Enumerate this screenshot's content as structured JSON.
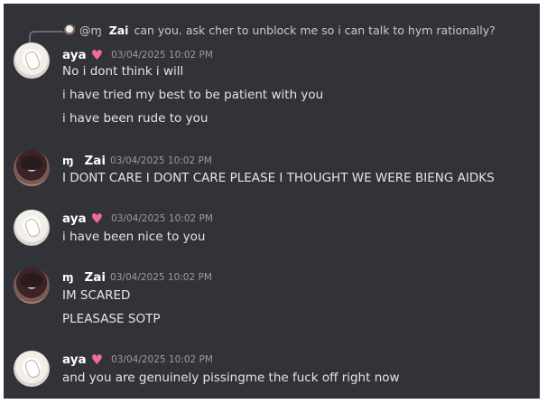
{
  "reply": {
    "avatar_icon": "user-avatar-icon",
    "mention": "@",
    "clan_icon": "ɱ",
    "author": "Zai",
    "text": "can you. ask cher to unblock me so i can talk to hym rationally?"
  },
  "messages": [
    {
      "author": "aya",
      "badge_icon": "heart-icon",
      "badge_glyph": "♥",
      "badge_color": "#f06aa1",
      "timestamp": "03/04/2025 10:02 PM",
      "lines": [
        "No i dont think i will",
        "i have tried my best to be patient with you",
        "i have been rude to you"
      ]
    },
    {
      "author": "Zai",
      "clan_glyph": "ɱ",
      "timestamp": "03/04/2025 10:02 PM",
      "lines": [
        "I DONT CARE I DONT CARE PLEASE I THOUGHT WE WERE BIENG AIDKS"
      ]
    },
    {
      "author": "aya",
      "badge_icon": "heart-icon",
      "badge_glyph": "♥",
      "badge_color": "#f06aa1",
      "timestamp": "03/04/2025 10:02 PM",
      "lines": [
        "i have been nice to you"
      ]
    },
    {
      "author": "Zai",
      "clan_glyph": "ɱ",
      "timestamp": "03/04/2025 10:02 PM",
      "lines": [
        "IM SCARED",
        "PLEASASE SOTP"
      ]
    },
    {
      "author": "aya",
      "badge_icon": "heart-icon",
      "badge_glyph": "♥",
      "badge_color": "#f06aa1",
      "timestamp": "03/04/2025 10:02 PM",
      "lines": [
        "and you are genuinely pissingme the fuck off right now"
      ]
    }
  ],
  "colors": {
    "background": "#323339",
    "text": "#e3e4e7",
    "timestamp": "#9a9ba2",
    "author": "#ffffff"
  }
}
